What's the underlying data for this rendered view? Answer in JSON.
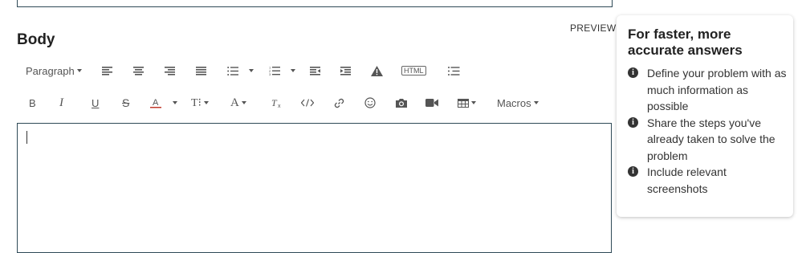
{
  "editor": {
    "section_title": "Body",
    "preview_label": "PREVIEW",
    "toolbar": {
      "paragraph_label": "Paragraph",
      "html_label": "HTML",
      "macros_label": "Macros",
      "text_size_label": "T⁝",
      "font_label": "A",
      "bold_label": "B",
      "italic_label": "I",
      "underline_label": "U",
      "strike_label": "S"
    },
    "body_value": ""
  },
  "tips": {
    "title": "For faster, more accurate answers",
    "items": [
      {
        "text": "Define your problem with as much information as possible"
      },
      {
        "text": "Share the steps you've already taken to solve the problem"
      },
      {
        "text": "Include relevant screenshots"
      }
    ],
    "icon": "info-circle-icon"
  }
}
